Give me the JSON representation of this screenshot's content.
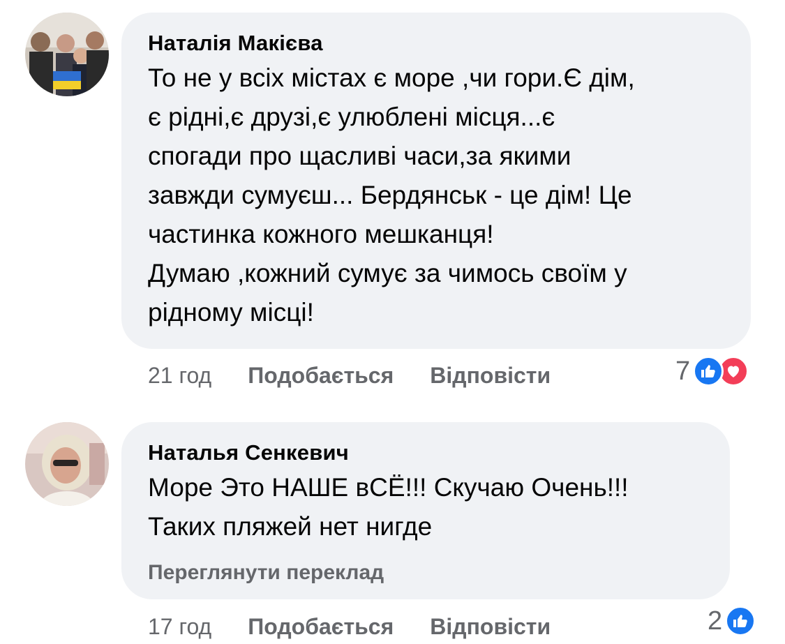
{
  "comments": [
    {
      "author": "Наталія Макієва",
      "avatar_icon": "avatar-family-photo",
      "text": "То не у всіх містах є море ,чи гори.Є дім,\nє рідні,є друзі,є улюблені місця...є\nспогади про щасливі часи,за якими\nзавжди сумуєш... Бердянськ - це дім! Це\nчастинка кожного мешканця!\nДумаю ,кожний сумує за чимось своїм у\nрідному місці!",
      "time": "21 год",
      "like_label": "Подобається",
      "reply_label": "Відповісти",
      "reaction_count": "7",
      "reactions": [
        "like-icon",
        "love-icon"
      ]
    },
    {
      "author": "Наталья Сенкевич",
      "avatar_icon": "avatar-woman-photo",
      "text": "Море Это НАШЕ вСЁ!!! Скучаю Очень!!!\nТаких пляжей нет нигде",
      "translate_label": "Переглянути переклад",
      "time": "17 год",
      "like_label": "Подобається",
      "reply_label": "Відповісти",
      "reaction_count": "2",
      "reactions": [
        "like-icon"
      ]
    }
  ],
  "colors": {
    "bubble": "#f0f2f5",
    "secondary_text": "#65676b",
    "like_blue": "#1877f2",
    "love_red": "#f33e58"
  }
}
